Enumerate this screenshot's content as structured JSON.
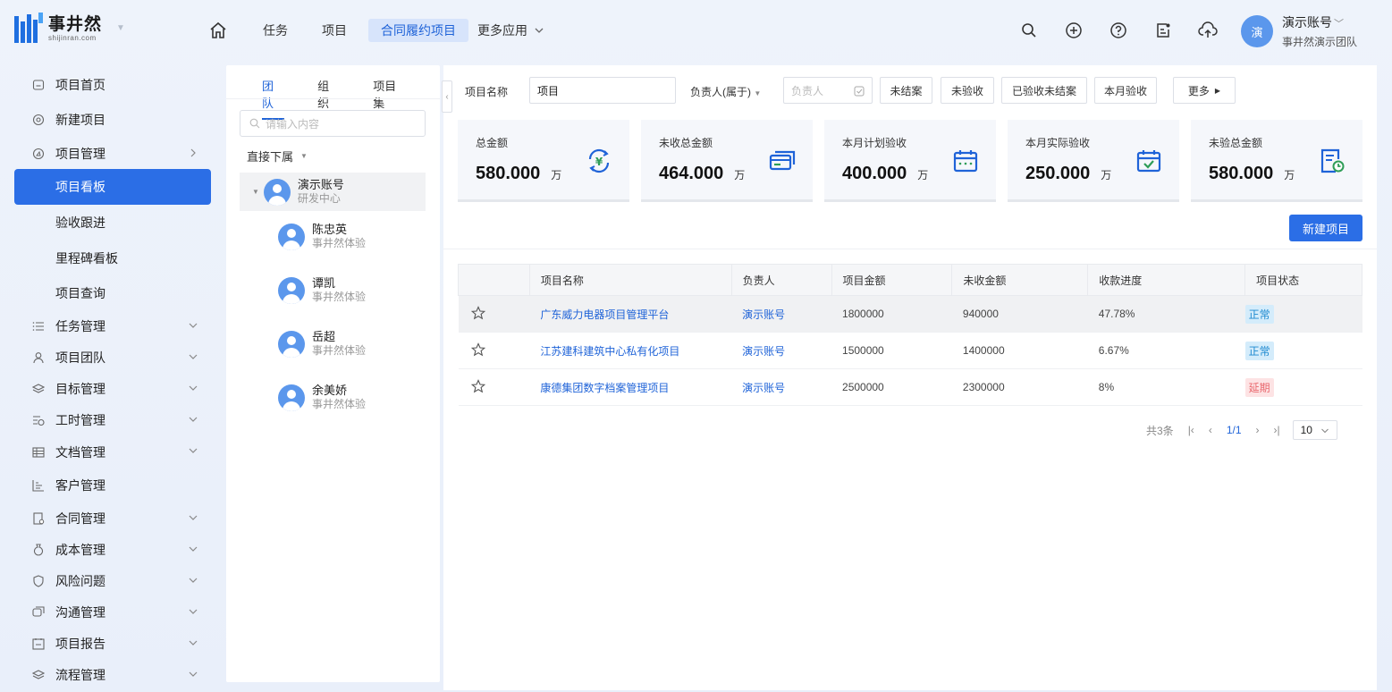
{
  "brand": {
    "name_cn": "事井然",
    "name_en": "shijinran.com"
  },
  "nav": {
    "items": [
      {
        "label": "任务"
      },
      {
        "label": "项目"
      },
      {
        "label": "合同履约项目",
        "active": true
      }
    ],
    "more_label": "更多应用"
  },
  "user": {
    "avatar_text": "演",
    "name": "演示账号",
    "team": "事井然演示团队"
  },
  "sidebar": {
    "items": [
      {
        "label": "项目首页",
        "icon": "home-icon"
      },
      {
        "label": "新建项目",
        "icon": "at-icon"
      },
      {
        "label": "项目管理",
        "icon": "compass-icon",
        "chevron": "right"
      },
      {
        "label": "项目看板",
        "sub": true,
        "active": true
      },
      {
        "label": "验收跟进",
        "sub": true
      },
      {
        "label": "里程碑看板",
        "sub": true
      },
      {
        "label": "项目查询",
        "sub": true
      },
      {
        "label": "任务管理",
        "icon": "list-icon",
        "chevron": "down"
      },
      {
        "label": "项目团队",
        "icon": "user-icon",
        "chevron": "down"
      },
      {
        "label": "目标管理",
        "icon": "layers-icon",
        "chevron": "down"
      },
      {
        "label": "工时管理",
        "icon": "timesheet-icon",
        "chevron": "down"
      },
      {
        "label": "文档管理",
        "icon": "table-icon",
        "chevron": "down"
      },
      {
        "label": "客户管理",
        "icon": "chart-icon"
      },
      {
        "label": "合同管理",
        "icon": "contract-icon",
        "chevron": "down"
      },
      {
        "label": "成本管理",
        "icon": "moneybag-icon",
        "chevron": "down"
      },
      {
        "label": "风险问题",
        "icon": "shield-icon",
        "chevron": "down"
      },
      {
        "label": "沟通管理",
        "icon": "chat-icon",
        "chevron": "down"
      },
      {
        "label": "项目报告",
        "icon": "report-icon",
        "chevron": "down"
      },
      {
        "label": "流程管理",
        "icon": "layers-icon",
        "chevron": "down"
      }
    ]
  },
  "midpanel": {
    "tabs": [
      {
        "label": "团队",
        "active": true
      },
      {
        "label": "组织"
      },
      {
        "label": "项目集"
      }
    ],
    "search_placeholder": "请输入内容",
    "filter_label": "直接下属",
    "root": {
      "name": "演示账号",
      "dept": "研发中心"
    },
    "members": [
      {
        "name": "陈忠英",
        "dept": "事井然体验"
      },
      {
        "name": "谭凯",
        "dept": "事井然体验"
      },
      {
        "name": "岳超",
        "dept": "事井然体验"
      },
      {
        "name": "余美娇",
        "dept": "事井然体验"
      }
    ]
  },
  "filters": {
    "name_label": "项目名称",
    "name_value": "项目",
    "owner_label": "负责人(属于)",
    "owner_placeholder": "负责人",
    "buttons": [
      "未结案",
      "未验收",
      "已验收未结案",
      "本月验收"
    ],
    "more_label": "更多"
  },
  "cards": [
    {
      "label": "总金额",
      "value": "580.000",
      "unit": "万",
      "icon": "yuan-cycle-icon"
    },
    {
      "label": "未收总金额",
      "value": "464.000",
      "unit": "万",
      "icon": "card-icon"
    },
    {
      "label": "本月计划验收",
      "value": "400.000",
      "unit": "万",
      "icon": "calendar-icon"
    },
    {
      "label": "本月实际验收",
      "value": "250.000",
      "unit": "万",
      "icon": "calendar-check-icon"
    },
    {
      "label": "未验总金额",
      "value": "580.000",
      "unit": "万",
      "icon": "doc-clock-icon"
    }
  ],
  "new_project_label": "新建项目",
  "table": {
    "headers": [
      "",
      "项目名称",
      "负责人",
      "项目金额",
      "未收金额",
      "收款进度",
      "项目状态"
    ],
    "rows": [
      {
        "name": "广东威力电器项目管理平台",
        "owner": "演示账号",
        "amount": "1800000",
        "unpaid": "940000",
        "progress": "47.78%",
        "status": "正常",
        "status_color": "#1f8ad0",
        "status_bg": "#d4ecfb"
      },
      {
        "name": "江苏建科建筑中心私有化项目",
        "owner": "演示账号",
        "amount": "1500000",
        "unpaid": "1400000",
        "progress": "6.67%",
        "status": "正常",
        "status_color": "#1f8ad0",
        "status_bg": "#d4ecfb"
      },
      {
        "name": "康德集团数字档案管理项目",
        "owner": "演示账号",
        "amount": "2500000",
        "unpaid": "2300000",
        "progress": "8%",
        "status": "延期",
        "status_color": "#e9696f",
        "status_bg": "#fde3e4"
      }
    ]
  },
  "pager": {
    "total": "共3条",
    "page": "1/1",
    "size": "10"
  }
}
